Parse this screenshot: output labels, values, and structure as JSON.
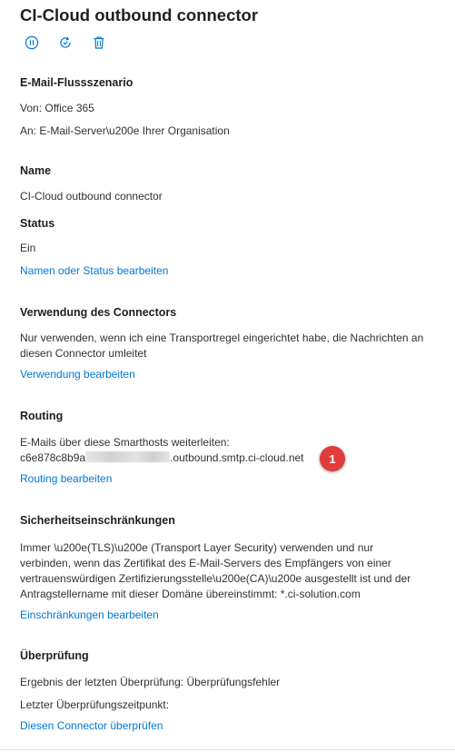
{
  "panel": {
    "title": "CI-Cloud outbound connector",
    "toolbar": [
      {
        "icon": "pause-icon",
        "color": "#0078d4"
      },
      {
        "icon": "refresh-icon",
        "color": "#0078d4"
      },
      {
        "icon": "trash-icon",
        "color": "#0078d4"
      }
    ]
  },
  "mail_flow": {
    "heading": "E-Mail-Flussszenario",
    "from": "Von: Office 365",
    "to": "An: E-Mail-Server\\u200e Ihrer Organisation"
  },
  "name": {
    "heading": "Name",
    "value": "CI-Cloud outbound connector"
  },
  "status": {
    "heading": "Status",
    "value": "Ein",
    "edit_link": "Namen oder Status bearbeiten"
  },
  "usage": {
    "heading": "Verwendung des Connectors",
    "description": "Nur verwenden, wenn ich eine Transportregel eingerichtet habe, die Nachrichten an diesen Connector umleitet",
    "edit_link": "Verwendung bearbeiten"
  },
  "routing": {
    "heading": "Routing",
    "label": "E-Mails über diese Smarthosts weiterleiten:",
    "host_prefix": "c6e878c8b9a",
    "host_suffix": ".outbound.smtp.ci-cloud.net",
    "badge": "1",
    "badge_color": "#e23b3b",
    "edit_link": "Routing bearbeiten"
  },
  "security": {
    "heading": "Sicherheitseinschränkungen",
    "lines": [
      "Immer \\u200e(TLS)\\u200e (Transport Layer Security) verwenden und nur",
      "verbinden, wenn das Zertifikat des E-Mail-Servers des Empfängers von einer",
      "vertrauenswürdigen Zertifizierungsstelle\\u200e(CA)\\u200e ausgestellt ist und der",
      "Antragstellername mit dieser Domäne übereinstimmt: *.ci-solution.com"
    ],
    "edit_link": "Einschränkungen bearbeiten"
  },
  "validation": {
    "heading": "Überprüfung",
    "last_result": "Ergebnis der letzten Überprüfung: Überprüfungsfehler",
    "last_time": "Letzter Überprüfungszeitpunkt:",
    "validate_link": "Diesen Connector überprüfen"
  },
  "colors": {
    "link": "#0078d4",
    "text": "#323130",
    "heading": "#201f1e"
  }
}
